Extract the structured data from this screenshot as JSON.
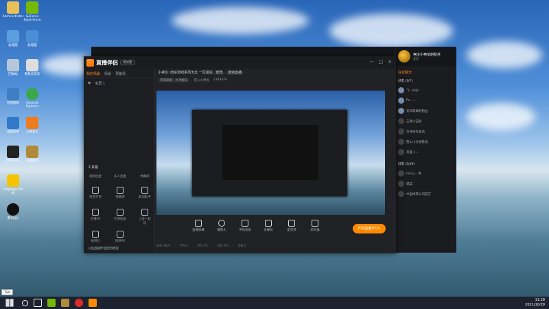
{
  "desktop": {
    "icons_col1": [
      "Administrator",
      "此电脑",
      "回收站",
      "控制面板",
      "桌面助手",
      "Ultimate",
      "Potplayer 64 bit",
      "腾讯QQ"
    ],
    "icons_col2": [
      "GeForce Experience",
      "此电脑",
      "网易云音乐",
      "Internet Explorer",
      "火绒安全",
      "英雄联盟"
    ]
  },
  "app": {
    "name": "直播伴侣",
    "version_badge": "测试版",
    "tabs": [
      "我的场景",
      "场景",
      "预备场"
    ],
    "scene_label": "全屏 1",
    "stream_title": "小神龙: 暗杀游戏系列无比 一区最后",
    "stream_title_edit": "修改",
    "source_pill": "游戏直播",
    "category": "英雄联盟 - 大神解说",
    "host_name": "宫心小神龙",
    "fans": "2148324",
    "tools_title": "工具箱",
    "tools_row1": [
      "视频连麦",
      "多人连麦",
      "弹幕库"
    ],
    "tools_row2": [
      "语音打赏",
      "弹幕库",
      "歌词助手"
    ],
    "tools_row3": [
      "主播PK",
      "礼物投屏",
      "上车一起玩"
    ],
    "tools_row4": [
      "福利社",
      "同屏PK"
    ],
    "bottom_note": "斗鱼直播伴侣使用教程",
    "controls": [
      "直播屏幕",
      "摄像头",
      "手机投屏",
      "多媒体",
      "麦克风",
      "扬声器"
    ],
    "go_live": "开始直播(F10)",
    "status": [
      "码率 0kb/s",
      "FPS 0",
      "CPU 4%",
      "内存 4%",
      "丢帧 0"
    ]
  },
  "chat": {
    "user": "宫庄小神龙的粉丝",
    "tag": "会员",
    "section_title": "好友聊天",
    "group1": "好友 (3/7)",
    "friends_online": [
      "飞 - Bq0",
      "Ps......",
      "刘日新鲜的粉丝"
    ],
    "friends_offline": [
      "王翔小丑粉",
      "吉祥海岛鱼苗",
      "西山小分级基地",
      "英雄 | 一"
    ],
    "group2": "好友 (3/19)",
    "friends2": [
      "Fancy - 熊",
      "咸菜",
      "中国绿茶公司官方"
    ]
  },
  "taskbar": {
    "time": "11:28",
    "date": "2021/10/29",
    "toast": "TSet"
  }
}
